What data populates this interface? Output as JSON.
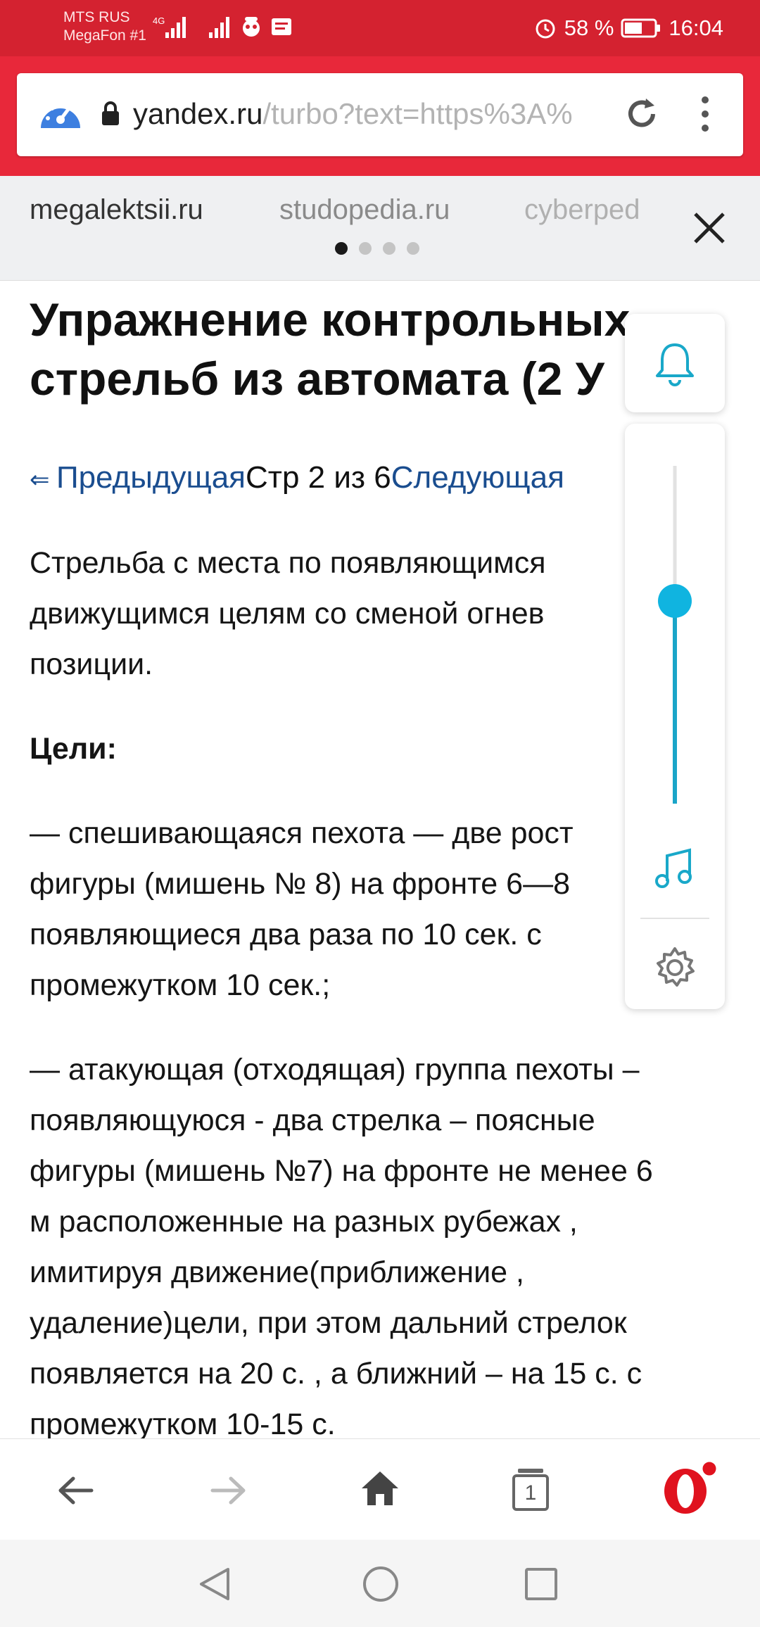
{
  "status_bar": {
    "carrier_1": "MTS RUS",
    "carrier_2": "MegaFon #1",
    "network_type": "4G",
    "battery": "58 %",
    "time": "16:04",
    "icons": [
      "signal-icon",
      "signal-icon",
      "notification-icon",
      "message-icon",
      "alarm-icon",
      "battery-icon"
    ]
  },
  "browser": {
    "url_domain": "yandex.ru",
    "url_path": "/turbo?text=https%3A%",
    "icons": [
      "speed-dial-icon",
      "lock-icon",
      "reload-icon",
      "more-icon"
    ]
  },
  "suggestions": {
    "items": [
      "megalektsii.ru",
      "studopedia.ru",
      "cyberped"
    ],
    "page_count": 4,
    "active_page": 1
  },
  "article": {
    "title_line_1": "Упражнение контрольных",
    "title_line_2": "стрельб из автомата (2 У",
    "pager": {
      "prev": "Предыдущая",
      "page_info": "Стр 2 из 6",
      "next": "Следующая"
    },
    "intro_lines": [
      "Стрельба с места по появляющимся",
      "движущимся целям со сменой огнев",
      "позиции."
    ],
    "targets_heading": "Цели:",
    "target_1_lines": [
      "— спешивающаяся пехота — две рост",
      "фигуры (мишень № 8) на фронте 6—8",
      "появляющиеся два раза по 10 сек. с",
      "промежутком 10 сек.;"
    ],
    "target_2_lines": [
      "— атакующая (отходящая) группа пехоты –",
      "появляющуюся - два стрелка – поясные",
      "фигуры (мишень №7) на фронте не менее 6",
      "м расположенные на разных рубежах ,",
      "имитируя движение(приближение ,",
      "удаление)цели, при этом дальний стрелок",
      "появляется на 20 с. , а ближний – на 15 с. с",
      "промежутком 10-15 с."
    ]
  },
  "float_panel": {
    "icons": [
      "bell-icon",
      "music-icon",
      "gear-icon"
    ],
    "slider_level": 0.6
  },
  "bottom_nav": {
    "tab_count": "1",
    "icons": [
      "back-arrow-icon",
      "forward-arrow-icon",
      "home-icon",
      "tabs-icon",
      "opera-menu-icon"
    ]
  },
  "system_nav": {
    "icons": [
      "system-back-icon",
      "system-home-icon",
      "system-recents-icon"
    ]
  }
}
